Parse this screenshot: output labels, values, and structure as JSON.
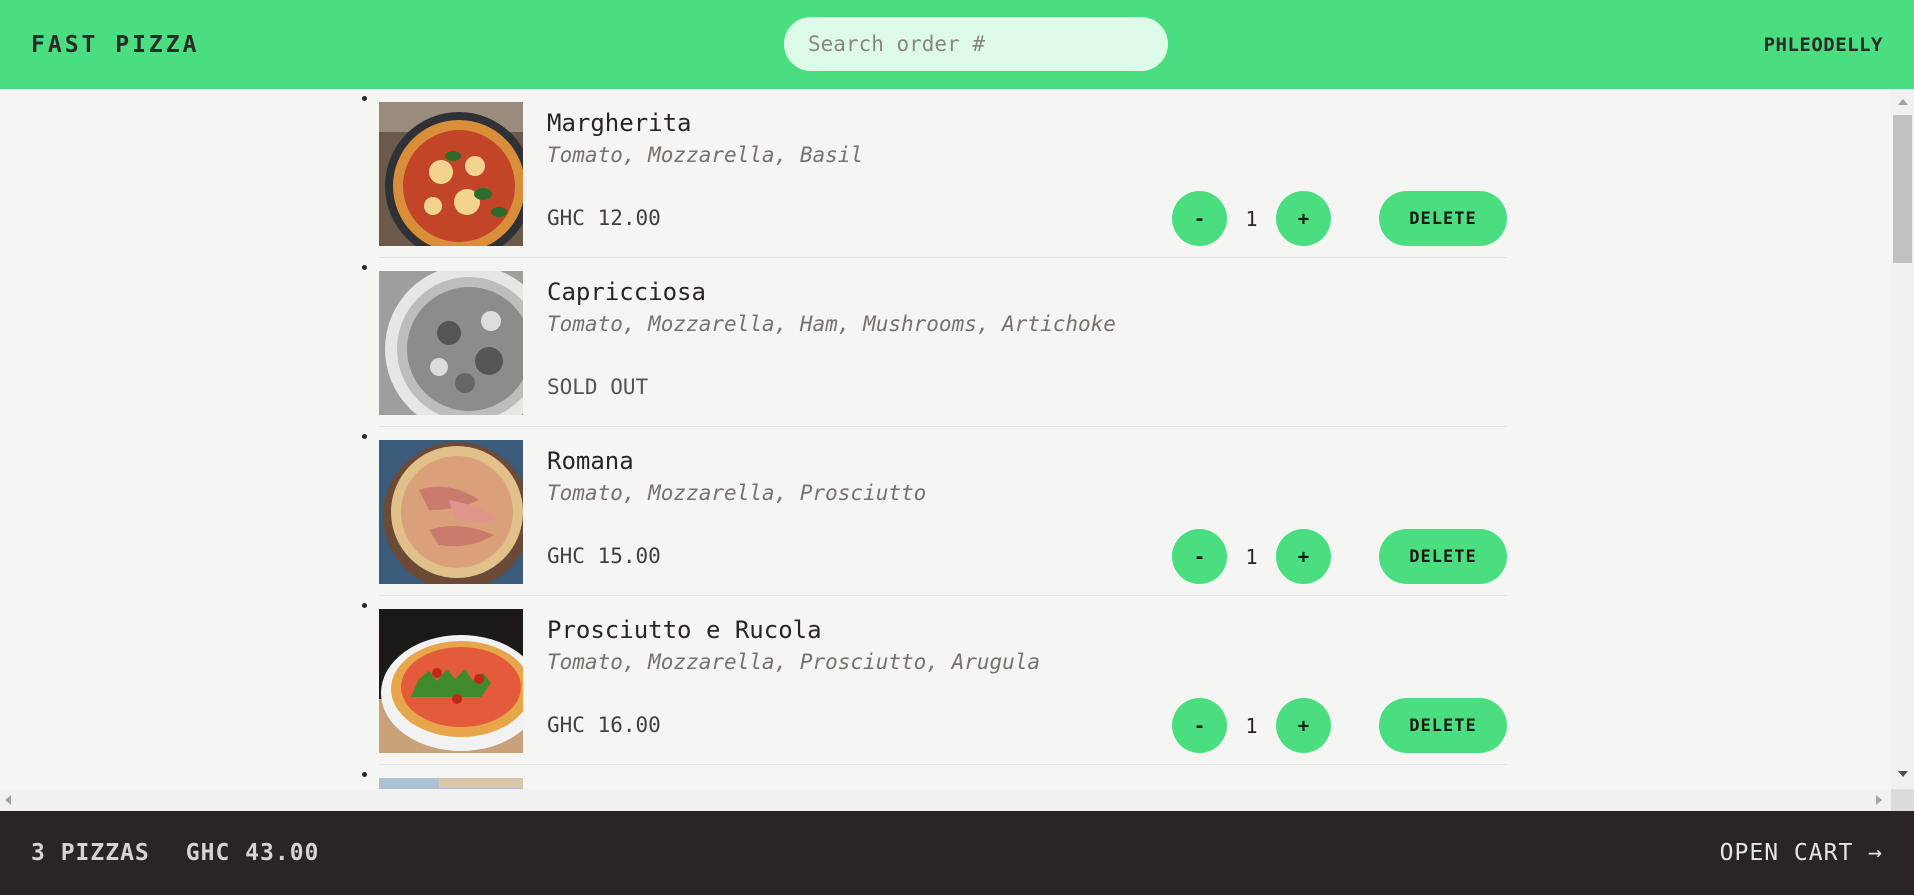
{
  "header": {
    "logo": "FAST PIZZA",
    "search_placeholder": "Search order #",
    "username": "PHLEODELLY"
  },
  "menu": {
    "items": [
      {
        "name": "Margherita",
        "ingredients": "Tomato, Mozzarella, Basil",
        "price": "GHC 12.00",
        "quantity": "1",
        "sold_out": false,
        "decrement_label": "-",
        "increment_label": "+",
        "delete_label": "DELETE"
      },
      {
        "name": "Capricciosa",
        "ingredients": "Tomato, Mozzarella, Ham, Mushrooms, Artichoke",
        "status": "SOLD OUT",
        "sold_out": true
      },
      {
        "name": "Romana",
        "ingredients": "Tomato, Mozzarella, Prosciutto",
        "price": "GHC 15.00",
        "quantity": "1",
        "sold_out": false,
        "decrement_label": "-",
        "increment_label": "+",
        "delete_label": "DELETE"
      },
      {
        "name": "Prosciutto e Rucola",
        "ingredients": "Tomato, Mozzarella, Prosciutto, Arugula",
        "price": "GHC 16.00",
        "quantity": "1",
        "sold_out": false,
        "decrement_label": "-",
        "increment_label": "+",
        "delete_label": "DELETE"
      }
    ]
  },
  "cart_overview": {
    "pizza_count": "3 PIZZAS",
    "total": "GHC 43.00",
    "open_cart": "OPEN CART →"
  },
  "colors": {
    "accent": "#4ade80",
    "footer_bg": "#292524",
    "page_bg": "#f5f5f4"
  }
}
